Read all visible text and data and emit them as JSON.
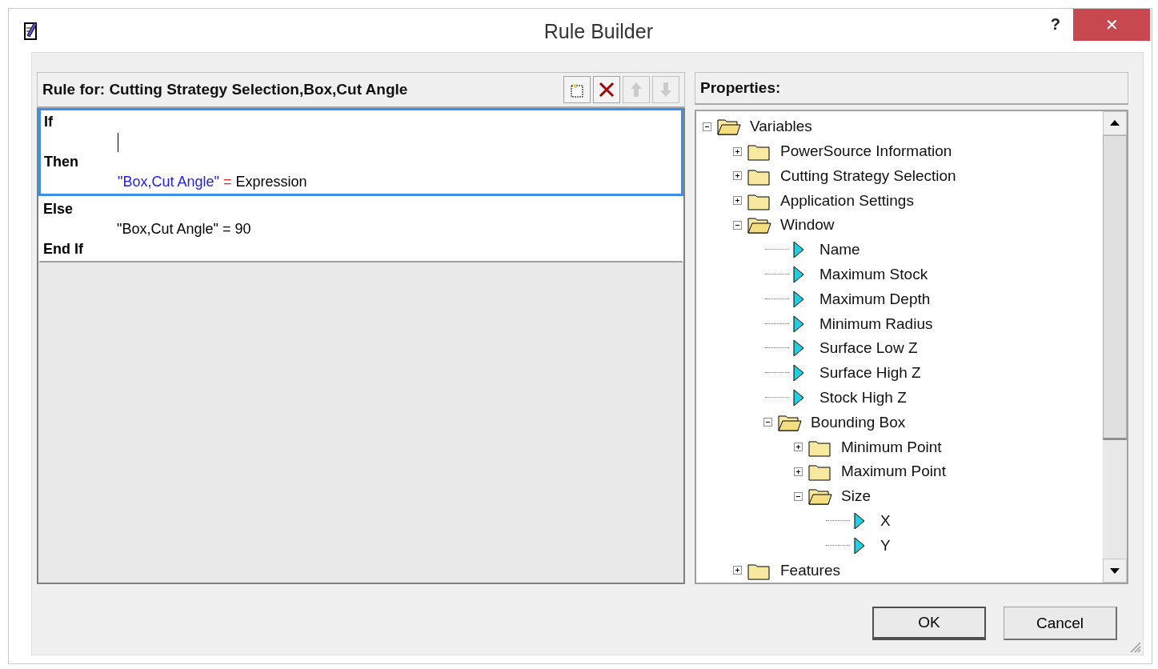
{
  "window": {
    "title": "Rule Builder",
    "help": "?",
    "close": "✕"
  },
  "rule_panel": {
    "header": "Rule for: Cutting Strategy Selection,Box,Cut Angle",
    "tools": [
      {
        "kind": "new",
        "disabled": false
      },
      {
        "kind": "delete",
        "disabled": false
      },
      {
        "kind": "up",
        "disabled": true
      },
      {
        "kind": "down",
        "disabled": true
      }
    ],
    "blocks": [
      {
        "selected": true,
        "lines": [
          {
            "kind": "keyword",
            "text": "If"
          },
          {
            "kind": "cursor"
          },
          {
            "kind": "keyword",
            "text": "Then"
          },
          {
            "kind": "assign",
            "colored": true,
            "target": "\"Box,Cut Angle\"",
            "op": "=",
            "value": "Expression"
          }
        ]
      },
      {
        "selected": false,
        "lines": [
          {
            "kind": "keyword",
            "text": "Else"
          },
          {
            "kind": "assign",
            "colored": false,
            "target": "\"Box,Cut Angle\"",
            "op": "=",
            "value": "90"
          },
          {
            "kind": "keyword",
            "text": "End If"
          }
        ]
      }
    ]
  },
  "properties": {
    "header": "Properties:",
    "tree": [
      {
        "kind": "folder",
        "label": "Variables",
        "expanded": true,
        "children": [
          {
            "kind": "folder",
            "label": "PowerSource Information",
            "expanded": false
          },
          {
            "kind": "folder",
            "label": "Cutting Strategy Selection",
            "expanded": false
          },
          {
            "kind": "folder",
            "label": "Application Settings",
            "expanded": false
          },
          {
            "kind": "folder",
            "label": "Window",
            "expanded": true,
            "children": [
              {
                "kind": "variable",
                "label": "Name"
              },
              {
                "kind": "variable",
                "label": "Maximum Stock"
              },
              {
                "kind": "variable",
                "label": "Maximum Depth"
              },
              {
                "kind": "variable",
                "label": "Minimum Radius"
              },
              {
                "kind": "variable",
                "label": "Surface Low Z"
              },
              {
                "kind": "variable",
                "label": "Surface High Z"
              },
              {
                "kind": "variable",
                "label": "Stock High Z"
              },
              {
                "kind": "folder",
                "label": "Bounding Box",
                "expanded": true,
                "children": [
                  {
                    "kind": "folder",
                    "label": "Minimum Point",
                    "expanded": false
                  },
                  {
                    "kind": "folder",
                    "label": "Maximum Point",
                    "expanded": false
                  },
                  {
                    "kind": "folder",
                    "label": "Size",
                    "expanded": true,
                    "children": [
                      {
                        "kind": "variable",
                        "label": "X"
                      },
                      {
                        "kind": "variable",
                        "label": "Y"
                      }
                    ]
                  }
                ]
              }
            ]
          },
          {
            "kind": "folder",
            "label": "Features",
            "expanded": false
          }
        ]
      }
    ]
  },
  "buttons": [
    {
      "label": "OK",
      "default": true
    },
    {
      "label": "Cancel",
      "default": false
    }
  ]
}
